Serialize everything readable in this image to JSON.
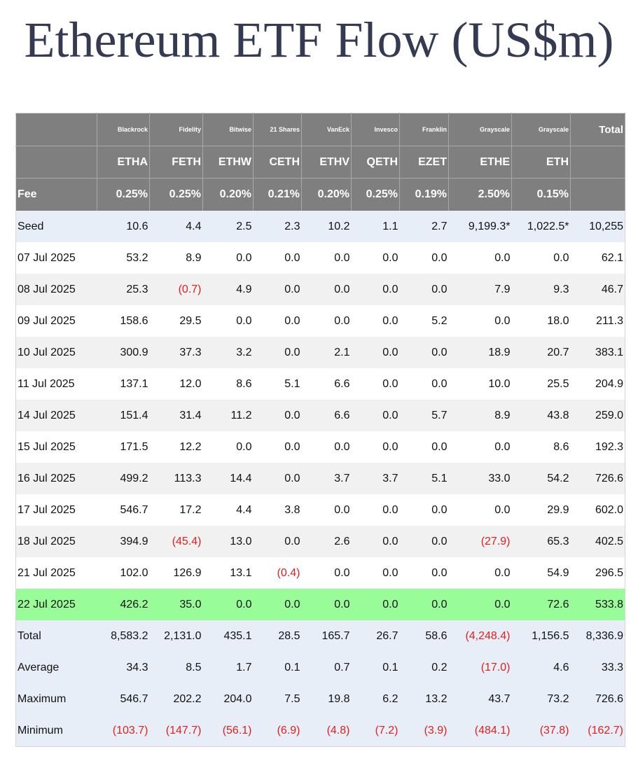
{
  "title": "Ethereum ETF Flow (US$m)",
  "colors": {
    "title": "#333a52",
    "header_bg": "#7f7f7f",
    "summary_bg": "#e8eef8",
    "highlight_bg": "#98fc98",
    "stripe_bg": "#f1f1f1",
    "negative": "#e0201c"
  },
  "header": {
    "issuers": [
      "Blackrock",
      "Fidelity",
      "Bitwise",
      "21 Shares",
      "VanEck",
      "Invesco",
      "Franklin",
      "Grayscale",
      "Grayscale"
    ],
    "total_label": "Total",
    "tickers": [
      "ETHA",
      "FETH",
      "ETHW",
      "CETH",
      "ETHV",
      "QETH",
      "EZET",
      "ETHE",
      "ETH"
    ],
    "fee_label": "Fee",
    "fees": [
      "0.25%",
      "0.25%",
      "0.20%",
      "0.21%",
      "0.20%",
      "0.25%",
      "0.19%",
      "2.50%",
      "0.15%"
    ]
  },
  "rows": [
    {
      "label": "Seed",
      "values": [
        "10.6",
        "4.4",
        "2.5",
        "2.3",
        "10.2",
        "1.1",
        "2.7",
        "9,199.3*",
        "1,022.5*",
        "10,255"
      ],
      "style": "blue"
    },
    {
      "label": "07 Jul 2025",
      "values": [
        "53.2",
        "8.9",
        "0.0",
        "0.0",
        "0.0",
        "0.0",
        "0.0",
        "0.0",
        "0.0",
        "62.1"
      ],
      "style": "white"
    },
    {
      "label": "08 Jul 2025",
      "values": [
        "25.3",
        "(0.7)",
        "4.9",
        "0.0",
        "0.0",
        "0.0",
        "0.0",
        "7.9",
        "9.3",
        "46.7"
      ],
      "style": "grey"
    },
    {
      "label": "09 Jul 2025",
      "values": [
        "158.6",
        "29.5",
        "0.0",
        "0.0",
        "0.0",
        "0.0",
        "5.2",
        "0.0",
        "18.0",
        "211.3"
      ],
      "style": "white"
    },
    {
      "label": "10 Jul 2025",
      "values": [
        "300.9",
        "37.3",
        "3.2",
        "0.0",
        "2.1",
        "0.0",
        "0.0",
        "18.9",
        "20.7",
        "383.1"
      ],
      "style": "grey"
    },
    {
      "label": "11 Jul 2025",
      "values": [
        "137.1",
        "12.0",
        "8.6",
        "5.1",
        "6.6",
        "0.0",
        "0.0",
        "10.0",
        "25.5",
        "204.9"
      ],
      "style": "white"
    },
    {
      "label": "14 Jul 2025",
      "values": [
        "151.4",
        "31.4",
        "11.2",
        "0.0",
        "6.6",
        "0.0",
        "5.7",
        "8.9",
        "43.8",
        "259.0"
      ],
      "style": "grey"
    },
    {
      "label": "15 Jul 2025",
      "values": [
        "171.5",
        "12.2",
        "0.0",
        "0.0",
        "0.0",
        "0.0",
        "0.0",
        "0.0",
        "8.6",
        "192.3"
      ],
      "style": "white"
    },
    {
      "label": "16 Jul 2025",
      "values": [
        "499.2",
        "113.3",
        "14.4",
        "0.0",
        "3.7",
        "3.7",
        "5.1",
        "33.0",
        "54.2",
        "726.6"
      ],
      "style": "grey"
    },
    {
      "label": "17 Jul 2025",
      "values": [
        "546.7",
        "17.2",
        "4.4",
        "3.8",
        "0.0",
        "0.0",
        "0.0",
        "0.0",
        "29.9",
        "602.0"
      ],
      "style": "white"
    },
    {
      "label": "18 Jul 2025",
      "values": [
        "394.9",
        "(45.4)",
        "13.0",
        "0.0",
        "2.6",
        "0.0",
        "0.0",
        "(27.9)",
        "65.3",
        "402.5"
      ],
      "style": "grey"
    },
    {
      "label": "21 Jul 2025",
      "values": [
        "102.0",
        "126.9",
        "13.1",
        "(0.4)",
        "0.0",
        "0.0",
        "0.0",
        "0.0",
        "54.9",
        "296.5"
      ],
      "style": "white"
    },
    {
      "label": "22 Jul 2025",
      "values": [
        "426.2",
        "35.0",
        "0.0",
        "0.0",
        "0.0",
        "0.0",
        "0.0",
        "0.0",
        "72.6",
        "533.8"
      ],
      "style": "green"
    },
    {
      "label": "Total",
      "values": [
        "8,583.2",
        "2,131.0",
        "435.1",
        "28.5",
        "165.7",
        "26.7",
        "58.6",
        "(4,248.4)",
        "1,156.5",
        "8,336.9"
      ],
      "style": "blue"
    },
    {
      "label": "Average",
      "values": [
        "34.3",
        "8.5",
        "1.7",
        "0.1",
        "0.7",
        "0.1",
        "0.2",
        "(17.0)",
        "4.6",
        "33.3"
      ],
      "style": "blue"
    },
    {
      "label": "Maximum",
      "values": [
        "546.7",
        "202.2",
        "204.0",
        "7.5",
        "19.8",
        "6.2",
        "13.2",
        "43.7",
        "73.2",
        "726.6"
      ],
      "style": "blue"
    },
    {
      "label": "Minimum",
      "values": [
        "(103.7)",
        "(147.7)",
        "(56.1)",
        "(6.9)",
        "(4.8)",
        "(7.2)",
        "(3.9)",
        "(484.1)",
        "(37.8)",
        "(162.7)"
      ],
      "style": "blue"
    }
  ]
}
